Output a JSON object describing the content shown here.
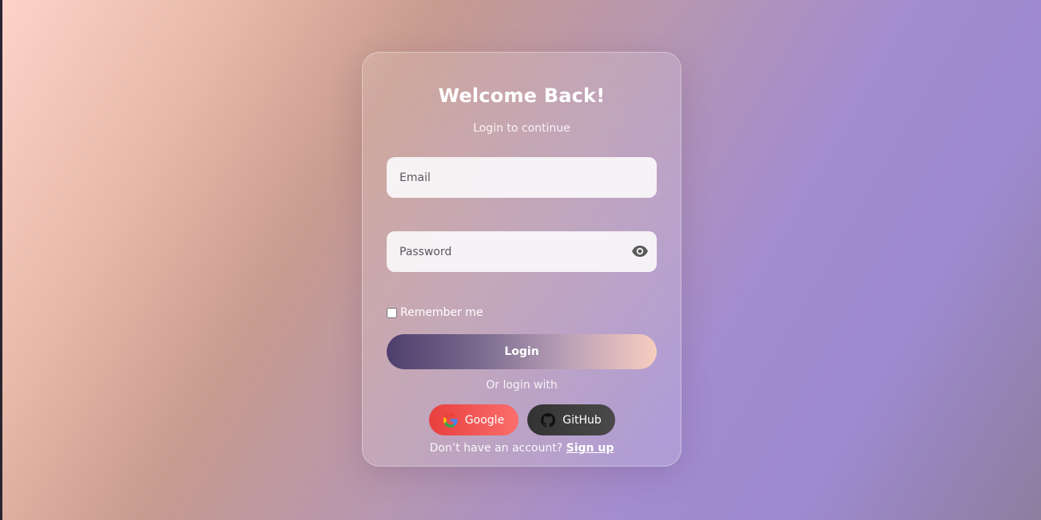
{
  "login_card": {
    "title": "Welcome Back!",
    "subtitle": "Login to continue",
    "email_placeholder": "Email",
    "password_placeholder": "Password",
    "remember_label": "Remember me",
    "login_label": "Login",
    "or_text": "Or login with",
    "google_label": "Google",
    "github_label": "GitHub",
    "signup_prompt": "Don’t have an account?",
    "signup_link": "Sign up"
  },
  "icons": {
    "password_toggle": "eye-icon",
    "google": "google-icon",
    "github": "github-icon"
  },
  "colors": {
    "google_button": "#f0504d",
    "github_button": "#3a3a3a",
    "login_gradient_start": "#4e3e6c",
    "login_gradient_end": "#f8cdc0"
  }
}
